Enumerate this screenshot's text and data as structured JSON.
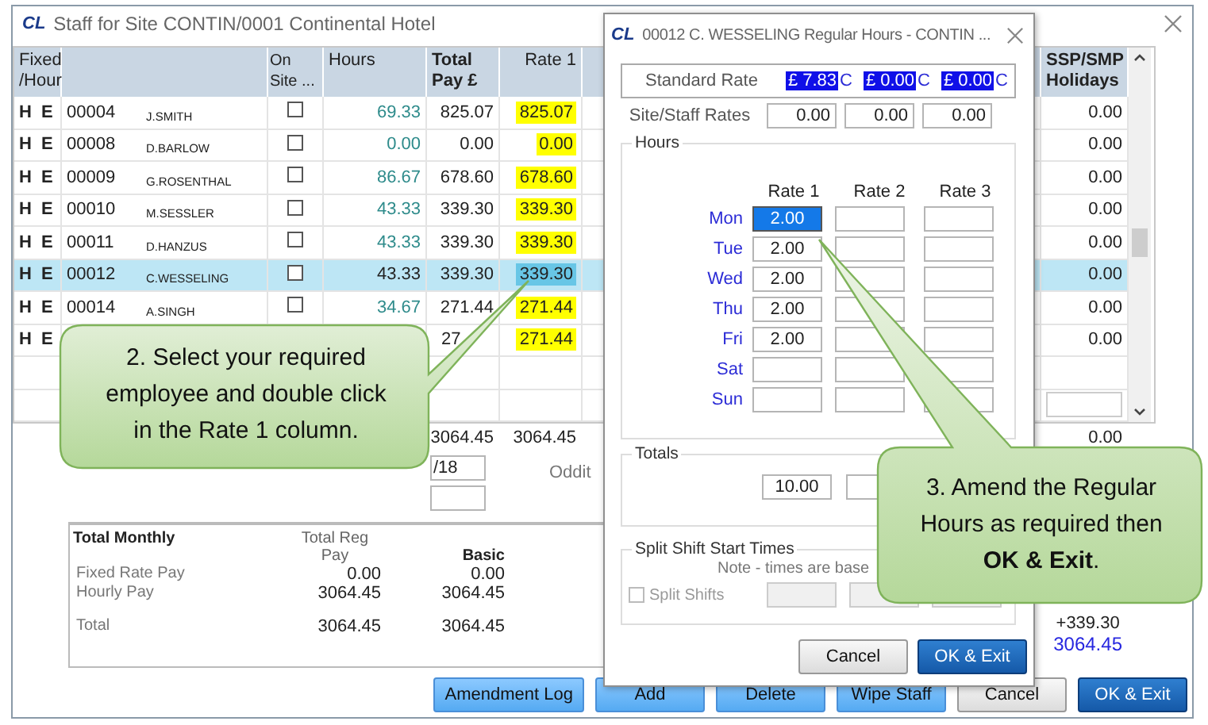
{
  "main_window": {
    "logo": "CL",
    "title": "Staff for Site CONTIN/0001 Continental Hotel"
  },
  "staff_table": {
    "columns": [
      "Fixed /Hour",
      "On Site ...",
      "Hours",
      "Total Pay £",
      "Rate 1",
      "SSP/SMP Holidays"
    ],
    "rows": [
      {
        "fixed": "H",
        "hour": "E",
        "code": "00004",
        "name": "J.SMITH",
        "on_site": false,
        "hours": "69.33",
        "total_pay": "825.07",
        "rate_1": "825.07",
        "ssp_smp": "0.00",
        "selected": false
      },
      {
        "fixed": "H",
        "hour": "E",
        "code": "00008",
        "name": "D.BARLOW",
        "on_site": false,
        "hours": "0.00",
        "total_pay": "0.00",
        "rate_1": "0.00",
        "ssp_smp": "0.00",
        "selected": false
      },
      {
        "fixed": "H",
        "hour": "E",
        "code": "00009",
        "name": "G.ROSENTHAL",
        "on_site": false,
        "hours": "86.67",
        "total_pay": "678.60",
        "rate_1": "678.60",
        "ssp_smp": "0.00",
        "selected": false
      },
      {
        "fixed": "H",
        "hour": "E",
        "code": "00010",
        "name": "M.SESSLER",
        "on_site": false,
        "hours": "43.33",
        "total_pay": "339.30",
        "rate_1": "339.30",
        "ssp_smp": "0.00",
        "selected": false
      },
      {
        "fixed": "H",
        "hour": "E",
        "code": "00011",
        "name": "D.HANZUS",
        "on_site": false,
        "hours": "43.33",
        "total_pay": "339.30",
        "rate_1": "339.30",
        "ssp_smp": "0.00",
        "selected": false
      },
      {
        "fixed": "H",
        "hour": "E",
        "code": "00012",
        "name": "C.WESSELING",
        "on_site": false,
        "hours": "43.33",
        "total_pay": "339.30",
        "rate_1": "339.30",
        "ssp_smp": "0.00",
        "selected": true
      },
      {
        "fixed": "H",
        "hour": "E",
        "code": "00014",
        "name": "A.SINGH",
        "on_site": false,
        "hours": "34.67",
        "total_pay": "271.44",
        "rate_1": "271.44",
        "ssp_smp": "0.00",
        "selected": false
      },
      {
        "fixed": "H",
        "hour": "E",
        "total_pay": "27",
        "rate_1": "271.44",
        "ssp_smp": "0.00",
        "selected": false
      }
    ]
  },
  "table_totals": {
    "total_pay": "3064.45",
    "rate_1": "3064.45",
    "ssp_smp": "0.00"
  },
  "date_field": {
    "value": "/18"
  },
  "oddit_label": "Oddit",
  "summary": {
    "title": "Total Monthly",
    "columns": [
      "Total Reg Pay",
      "Basic"
    ],
    "rows": [
      {
        "label": "Fixed Rate Pay",
        "values": [
          "0.00",
          "0.00"
        ]
      },
      {
        "label": "Hourly Pay",
        "values": [
          "3064.45",
          "3064.45"
        ]
      },
      {
        "label": "Total",
        "values": [
          "3064.45",
          "3064.45"
        ]
      }
    ]
  },
  "adjustment": "+339.30",
  "grand_total": "3064.45",
  "buttons": [
    {
      "label": "Amendment Log",
      "kind": "light"
    },
    {
      "label": "Add",
      "kind": "light"
    },
    {
      "label": "Delete",
      "kind": "light"
    },
    {
      "label": "Wipe Staff",
      "kind": "light"
    },
    {
      "label": "Cancel",
      "kind": "secondary"
    },
    {
      "label": "OK & Exit",
      "kind": "primary"
    }
  ],
  "dialog": {
    "logo": "CL",
    "title": "00012 C. WESSELING  Regular Hours - CONTIN ...",
    "standard_rate": {
      "label": "Standard Rate",
      "rates": [
        {
          "amount": "£ 7.83",
          "suffix": "C"
        },
        {
          "amount": "£ 0.00",
          "suffix": "C"
        },
        {
          "amount": "£ 0.00",
          "suffix": "C"
        }
      ]
    },
    "site_staff_rates": {
      "label": "Site/Staff Rates",
      "values": [
        "0.00",
        "0.00",
        "0.00"
      ]
    },
    "hours": {
      "label": "Hours",
      "columns": [
        "Rate 1",
        "Rate 2",
        "Rate 3"
      ],
      "days": [
        {
          "day": "Mon",
          "rate_1": "2.00",
          "selected": true
        },
        {
          "day": "Tue",
          "rate_1": "2.00",
          "selected": false
        },
        {
          "day": "Wed",
          "rate_1": "2.00",
          "selected": false
        },
        {
          "day": "Thu",
          "rate_1": "2.00",
          "selected": false
        },
        {
          "day": "Fri",
          "rate_1": "2.00",
          "selected": false
        },
        {
          "day": "Sat",
          "selected": false
        },
        {
          "day": "Sun",
          "selected": false
        }
      ]
    },
    "totals": {
      "label": "Totals",
      "values": [
        "10.00"
      ]
    },
    "split_shift": {
      "label": "Split Shift Start Times",
      "note": "Note - times are base",
      "checkbox_label": "Split Shifts",
      "checked": false
    },
    "buttons": [
      {
        "label": "Cancel",
        "kind": "secondary"
      },
      {
        "label": "OK & Exit",
        "kind": "primary"
      }
    ]
  },
  "callouts": [
    {
      "text": "2. Select your required employee and double click in the Rate 1 column."
    },
    {
      "text": "3. Amend the Regular Hours as required then **OK & Exit**."
    }
  ]
}
